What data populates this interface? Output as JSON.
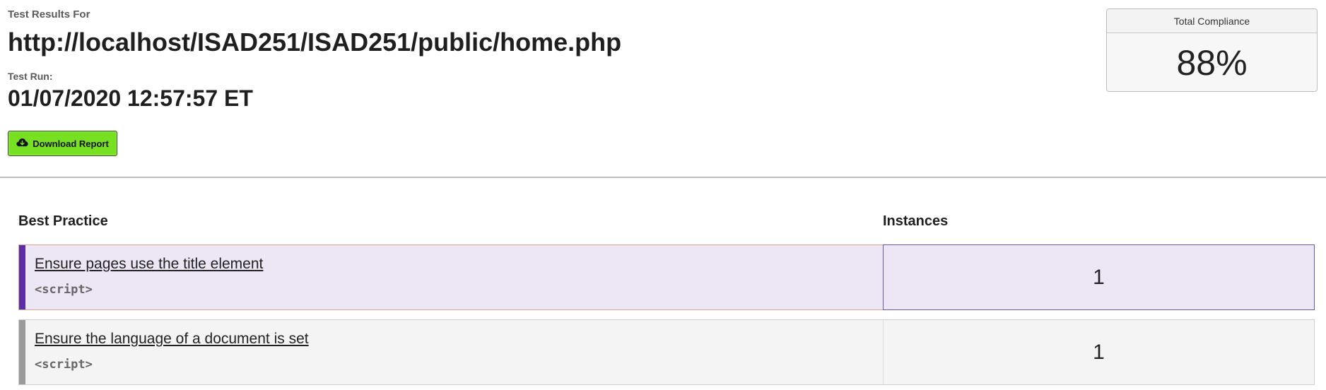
{
  "header": {
    "results_label": "Test Results For",
    "url": "http://localhost/ISAD251/ISAD251/public/home.php",
    "run_label": "Test Run:",
    "run_date": "01/07/2020 12:57:57 ET",
    "download_label": "Download Report",
    "download_icon": "cloud-download-icon"
  },
  "compliance": {
    "title": "Total Compliance",
    "value": "88%"
  },
  "table": {
    "headers": {
      "practice": "Best Practice",
      "instances": "Instances"
    },
    "rows": [
      {
        "practice": "Ensure pages use the title element",
        "code": "<script>",
        "instances": "1",
        "accent_color": "#5b2ea8"
      },
      {
        "practice": "Ensure the language of a document is set",
        "code": "<script>",
        "instances": "1",
        "accent_color": "#9a9a9a"
      }
    ]
  },
  "colors": {
    "download_button": "#76e021",
    "selected_row_bg": "#ede6f4"
  }
}
